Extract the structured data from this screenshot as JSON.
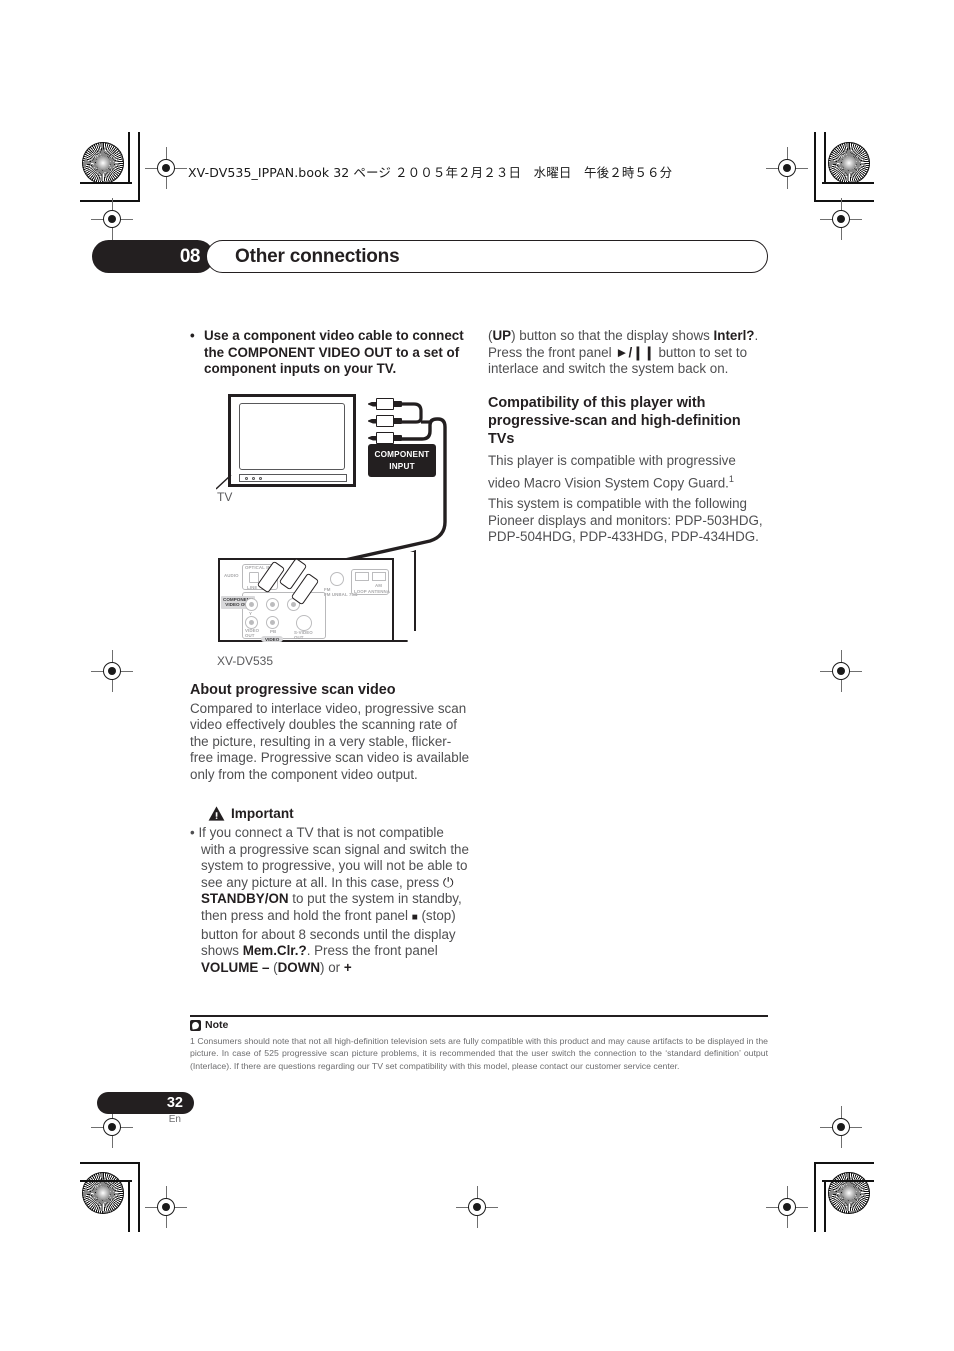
{
  "print_marks": {
    "file_line": "XV-DV535_IPPAN.book  32 ページ  ２００５年２月２３日　水曜日　午後２時５６分"
  },
  "chapter_header": {
    "number": "08",
    "title": "Other connections"
  },
  "left_column": {
    "bullet_intro": {
      "bullet": "•",
      "text_part1": "Use a component video cable to connect the ",
      "bold_term": "COMPONENT VIDEO OUT",
      "text_part2": " to a set of component inputs on your TV."
    },
    "diagram": {
      "tv_label": "TV",
      "component_input_line1": "COMPONENT",
      "component_input_line2": "INPUT",
      "device_label": "XV-DV535",
      "rear_labels": {
        "optical_in": "OPTICAL IN",
        "audio": "AUDIO",
        "line": "LINE",
        "component_video_out_line1": "COMPONENT",
        "component_video_out_line2": "VIDEO OUT",
        "video_out_line1": "VIDEO",
        "video_out_line2": "OUT",
        "svideo_out_line1": "S-VIDEO",
        "svideo_out_line2": "OUT",
        "video_group": "VIDEO",
        "fm_unbal": "FM UNBAL 75Ω",
        "loop_antenna": "LOOP ANTENNA",
        "fm_small": "FM",
        "am_small": "AM",
        "y_jack": "Y",
        "pb_jack": "PB",
        "pr_jack": "PR"
      }
    },
    "about_section": {
      "heading": "About progressive scan video",
      "body": "Compared to interlace video, progressive scan video effectively doubles the scanning rate of the picture, resulting in a very stable, flicker-free image. Progressive scan video is available only from the component video output."
    },
    "important": {
      "heading": "Important",
      "bullet": "•",
      "seg1": "If you connect a TV that is not compatible with a progressive scan signal and switch the system to progressive, you will not be able to see any picture at all. In this case, press ",
      "power_glyph": "⏻",
      "bold1": "STANDBY/ON",
      "seg2": " to put the system in standby, then press and hold the front panel ",
      "stop_glyph": "■",
      "seg3": " (stop) button for about 8 seconds until the display shows ",
      "bold2": "Mem.Clr.?",
      "seg4": ". Press the front panel ",
      "bold3": "VOLUME –",
      "seg5": " (",
      "bold4": "DOWN",
      "seg6": ") or ",
      "bold5": "+"
    }
  },
  "right_column": {
    "continued": {
      "seg1": "(",
      "bold1": "UP",
      "seg2": ") button so that the display shows ",
      "bold2": "Interl?",
      "seg3": ". Press the front panel ",
      "playpause_glyph": "►/❙❙",
      "seg4": " button to set to interlace and switch the system back on."
    },
    "compatibility": {
      "heading_line1": "Compatibility of this player with",
      "heading_line2": "progressive-scan and high-definition TVs",
      "para1": "This player is compatible with progressive video Macro Vision System Copy Guard.",
      "para1_footnote_ref": "1",
      "para2": "This system is compatible with the following Pioneer displays and monitors: PDP-503HDG, PDP-504HDG, PDP-433HDG, PDP-434HDG."
    }
  },
  "footnote": {
    "label": "Note",
    "text": "1 Consumers should note that not all high-definition television sets are fully compatible with this product and may cause artifacts to be displayed in the picture. In case of 525 progressive scan picture problems, it is recommended that the user switch the connection to the ‘standard definition’ output (Interlace). If there are questions regarding our TV set compatibility with this model, please contact our customer service center."
  },
  "page_footer": {
    "number": "32",
    "language": "En"
  },
  "colors": {
    "ink": "#231f20",
    "body_gray": "#4f4f51",
    "note_gray": "#6d6d6f",
    "panel_light": "#bcbcbe"
  }
}
